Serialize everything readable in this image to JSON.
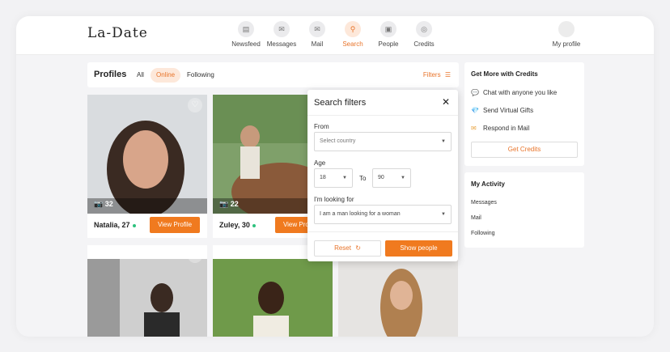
{
  "app": {
    "logo": "La-Date"
  },
  "nav": [
    {
      "label": "Newsfeed",
      "icon": "newsfeed-icon",
      "glyph": "▤",
      "active": false
    },
    {
      "label": "Messages",
      "icon": "messages-icon",
      "glyph": "✉",
      "active": false
    },
    {
      "label": "Mail",
      "icon": "mail-icon",
      "glyph": "✉",
      "active": false
    },
    {
      "label": "Search",
      "icon": "search-icon",
      "glyph": "⚲",
      "active": true
    },
    {
      "label": "People",
      "icon": "people-icon",
      "glyph": "▣",
      "active": false
    },
    {
      "label": "Credits",
      "icon": "credits-icon",
      "glyph": "◎",
      "active": false
    }
  ],
  "profile_nav": {
    "label": "My profile"
  },
  "profiles_bar": {
    "title": "Profiles",
    "tabs": [
      {
        "label": "All",
        "active": false
      },
      {
        "label": "Online",
        "active": true
      },
      {
        "label": "Following",
        "active": false
      }
    ],
    "filters_label": "Filters"
  },
  "cards": [
    {
      "name": "Natalia, 27",
      "photo_count": "32",
      "view_label": "View Profile"
    },
    {
      "name": "Zuley, 30",
      "photo_count": "22",
      "view_label": "View Profile"
    }
  ],
  "filters_modal": {
    "title": "Search filters",
    "from_label": "From",
    "country_placeholder": "Select country",
    "age_label": "Age",
    "age_from": "18",
    "age_to_label": "To",
    "age_to": "90",
    "looking_label": "I'm looking for",
    "looking_value": "I am a man looking for a woman",
    "reset_label": "Reset",
    "show_label": "Show people"
  },
  "credits_panel": {
    "title": "Get More with Credits",
    "items": [
      {
        "label": "Chat with anyone you like",
        "icon": "chat-icon"
      },
      {
        "label": "Send Virtual Gifts",
        "icon": "gift-icon"
      },
      {
        "label": "Respond in Mail",
        "icon": "mail-icon"
      }
    ],
    "button_label": "Get Credits"
  },
  "activity_panel": {
    "title": "My Activity",
    "items": [
      "Messages",
      "Mail",
      "Following"
    ]
  },
  "colors": {
    "accent": "#f07a1f",
    "online": "#2ec27e"
  }
}
